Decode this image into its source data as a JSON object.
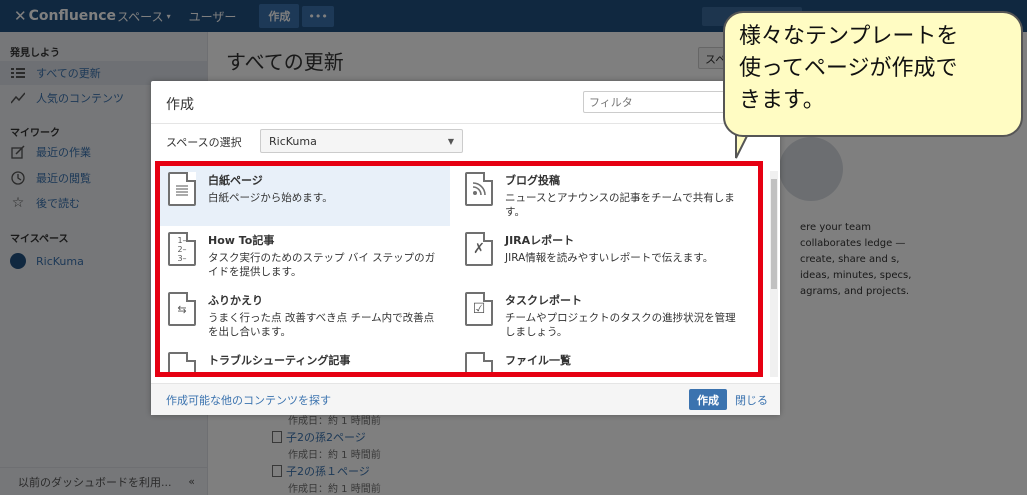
{
  "topnav": {
    "logo": "Confluence",
    "spaces": "スペース",
    "users": "ユーザー",
    "create": "作成",
    "more": "•••"
  },
  "sidebar": {
    "section_discover": "発見しよう",
    "item_all_updates": "すべての更新",
    "item_popular": "人気のコンテンツ",
    "section_mywork": "マイワーク",
    "item_recent_work": "最近の作業",
    "item_recent_viewed": "最近の閲覧",
    "item_read_later": "後で読む",
    "section_myspace": "マイスペース",
    "item_space": "RicKuma",
    "footer": "以前のダッシュボードを利用...",
    "collapse": "«"
  },
  "main": {
    "title": "すべての更新",
    "right_button": "スペ",
    "bg_text": "ere your team collaborates ledge — create, share and s, ideas, minutes, specs, agrams, and projects.",
    "feed": [
      {
        "meta": "作成日：約 1 時間前"
      },
      {
        "link": "子2の孫2ページ",
        "meta": "作成日：約 1 時間前"
      },
      {
        "link": "子2の孫１ページ",
        "meta": "作成日：約 1 時間前"
      }
    ]
  },
  "dialog": {
    "title": "作成",
    "filter_placeholder": "フィルタ",
    "space_label": "スペースの選択",
    "space_value": "RicKuma",
    "templates": [
      {
        "name": "白紙ページ",
        "desc": "白紙ページから始めます。"
      },
      {
        "name": "ブログ投稿",
        "desc": "ニュースとアナウンスの記事をチームで共有します。"
      },
      {
        "name": "How To記事",
        "desc": "タスク実行のためのステップ バイ ステップのガイドを提供します。"
      },
      {
        "name": "JIRAレポート",
        "desc": "JIRA情報を読みやすいレポートで伝えます。"
      },
      {
        "name": "ふりかえり",
        "desc": "うまく行った点 改善すべき点 チーム内で改善点を出し合います。"
      },
      {
        "name": "タスクレポート",
        "desc": "チームやプロジェクトのタスクの進捗状況を管理しましょう。"
      },
      {
        "name": "トラブルシューティング記事",
        "desc": ""
      },
      {
        "name": "ファイル一覧",
        "desc": ""
      }
    ],
    "more_link": "作成可能な他のコンテンツを探す",
    "create_button": "作成",
    "close_link": "閉じる"
  },
  "callout": {
    "line1": "様々なテンプレートを",
    "line2": "使ってページが作成で",
    "line3": "きます。"
  },
  "colors": {
    "nav": "#205081",
    "accent": "#3b73af",
    "highlight_border": "#e60012",
    "callout_bg": "#fffcc3"
  }
}
